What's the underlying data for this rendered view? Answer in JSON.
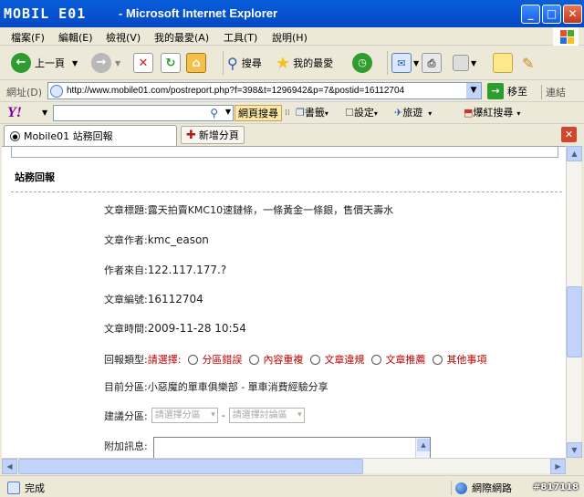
{
  "window": {
    "logo_text": "MOBIL E01",
    "title": "- Microsoft Internet Explorer"
  },
  "menubar": {
    "items": [
      "檔案(F)",
      "編輯(E)",
      "檢視(V)",
      "我的最愛(A)",
      "工具(T)",
      "說明(H)"
    ]
  },
  "toolbar": {
    "back_label": "上一頁",
    "search_label": "搜尋",
    "favorites_label": "我的最愛"
  },
  "address": {
    "label": "網址(D)",
    "url": "http://www.mobile01.com/postreport.php?f=398&t=1296942&p=7&postid=16112704",
    "go_label": "移至",
    "links_label": "連結"
  },
  "yahoo": {
    "logo": "Y!",
    "search_button": "網頁搜尋",
    "bookmarks": "書籤",
    "settings": "設定",
    "travel": "旅遊",
    "hot_search": "爆紅搜尋"
  },
  "tabs": {
    "active_label": "Mobile01 站務回報",
    "new_tab_label": "新增分頁"
  },
  "report": {
    "section_title": "站務回報",
    "article_title_label": "文章標題:",
    "article_title": "露天拍賣KMC10速鏈條，一條黃金一條銀，售價天壽水",
    "author_label": "文章作者:",
    "author": "kmc_eason",
    "from_label": "作者來自:",
    "from": "122.117.177.?",
    "id_label": "文章編號:",
    "id": "16112704",
    "time_label": "文章時間:",
    "time": "2009-11-28 10:54",
    "type_label": "回報類型:",
    "type_prompt": "請選擇:",
    "type_options": [
      "分區錯誤",
      "內容重複",
      "文章違規",
      "文章推薦",
      "其他事項"
    ],
    "current_category_label": "目前分區:",
    "current_category": "小惡魔的單車俱樂部 - 單車消費經驗分享",
    "suggest_label": "建議分區:",
    "suggest_select_1": "請選擇分區",
    "suggest_separator": "-",
    "suggest_select_2": "請選擇討論區",
    "message_label": "附加訊息:"
  },
  "status": {
    "done": "完成",
    "zone": "網際網路",
    "watermark": "#817118"
  }
}
